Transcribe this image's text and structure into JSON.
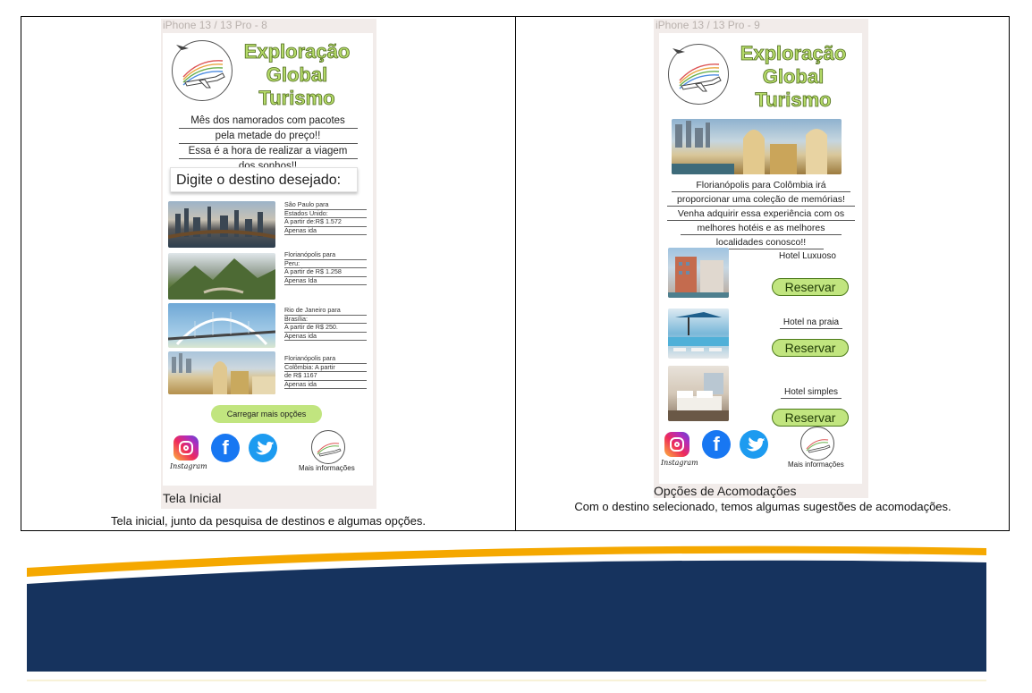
{
  "left": {
    "frame_label": "iPhone 13 / 13 Pro - 8",
    "brand": [
      "Exploração",
      "Global",
      "Turismo"
    ],
    "promo_lines": [
      "Mês dos namorados com pacotes",
      "pela metade do preço!!",
      "Essa é a hora de realizar a viagem",
      "dos sonhos!!"
    ],
    "search_placeholder": "Digite o destino desejado:",
    "deals": [
      {
        "lines": [
          "São Paulo para",
          "Estados Unido:",
          "A partir de:R$ 1.572",
          "Apenas ida"
        ]
      },
      {
        "lines": [
          "Florianópolis para",
          "Peru:",
          "A partir de R$ 1.258",
          "Apenas Ida"
        ]
      },
      {
        "lines": [
          "Rio de Janeiro para",
          "Brasília:",
          "A partir de R$ 250.",
          "Apenas ida"
        ]
      },
      {
        "lines": [
          "Florianópolis para",
          "Colômbia: A partir",
          "de R$ 1167",
          "Apenas ida"
        ]
      }
    ],
    "load_more": "Carregar mais opções",
    "instagram_word": "Instagram",
    "more_info": "Mais informações",
    "screen_title": "Tela Inicial",
    "caption": "Tela inicial, junto da pesquisa de destinos e algumas opções."
  },
  "right": {
    "frame_label": "iPhone 13 / 13 Pro - 9",
    "brand": [
      "Exploração",
      "Global",
      "Turismo"
    ],
    "promo_lines": [
      "Florianópolis para Colômbia irá",
      "proporcionar uma coleção de memórias!",
      "Venha adquirir essa experiência com os",
      "melhores hotéis e as melhores",
      "localidades conosco!!"
    ],
    "hotels": [
      {
        "name": "Hotel Luxuoso",
        "button": "Reservar"
      },
      {
        "name": "Hotel na praia",
        "button": "Reservar"
      },
      {
        "name": "Hotel simples",
        "button": "Reservar"
      }
    ],
    "instagram_word": "Instagram",
    "more_info": "Mais informações",
    "screen_title": "Opções de Acomodações",
    "caption": "Com o destino selecionado, temos algumas sugestões de acomodações."
  },
  "colors": {
    "accent_green": "#c1e57f",
    "brand_green": "#b6dc6a",
    "footer_navy": "#16335e",
    "footer_orange": "#f5a800"
  }
}
